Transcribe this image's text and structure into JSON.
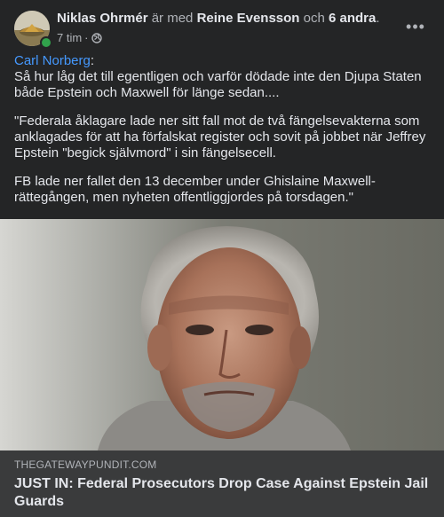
{
  "post": {
    "author": "Niklas Ohrmér",
    "with_text": "är med",
    "tagged_person": "Reine Evensson",
    "and_text": "och",
    "others": "6 andra",
    "period": ".",
    "time": "7 tim",
    "time_separator": "·",
    "privacy_icon": "globe-icon",
    "more_icon": "more-options-icon",
    "more_label": "•••",
    "online_color": "#31a24c"
  },
  "content": {
    "mention": "Carl Norberg",
    "mention_suffix": ":",
    "line1": "Så hur låg det till egentligen och varför dödade inte den Djupa Staten både Epstein och Maxwell för länge sedan....",
    "paragraph2": "\"Federala åklagare lade ner sitt fall mot de två fängelsevakterna som anklagades för att ha förfalskat register och sovit på jobbet när Jeffrey Epstein \"begick självmord\" i sin fängelsecell.",
    "paragraph3": "FB lade ner fallet den 13 december under Ghislaine Maxwell-rättegången, men nyheten offentliggjordes på torsdagen.\""
  },
  "link_preview": {
    "domain": "THEGATEWAYPUNDIT.COM",
    "title": "JUST IN: Federal Prosecutors Drop Case Against Epstein Jail Guards"
  },
  "colors": {
    "background": "#242526",
    "link_bg": "#3a3b3c",
    "mention": "#4599ff"
  }
}
